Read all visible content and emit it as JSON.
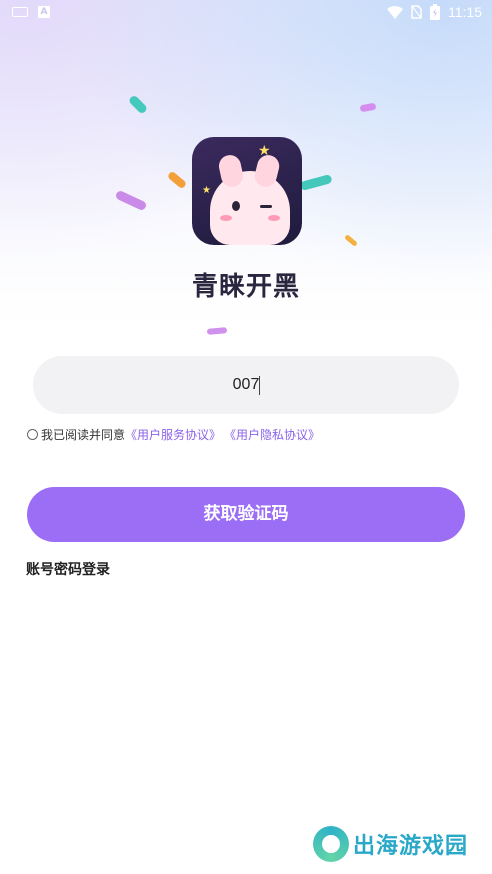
{
  "status_bar": {
    "time": "11:15",
    "icons": [
      "keyboard-icon",
      "a-icon",
      "wifi-icon",
      "no-sim-icon",
      "battery-icon"
    ]
  },
  "app": {
    "name": "青睐开黑",
    "logo_icon": "app-logo-bunny"
  },
  "form": {
    "phone_value": "007",
    "agreement": {
      "prefix": "我已阅读并同意",
      "service_link": "《用户服务协议》",
      "privacy_link": "《用户隐私协议》",
      "checked": false
    },
    "get_code_button": "获取验证码",
    "password_login_link": "账号密码登录"
  },
  "watermark": {
    "text": "出海游戏园"
  },
  "colors": {
    "accent": "#9b6ef5",
    "link": "#8a62e8",
    "input_bg": "#f2f2f4",
    "watermark": "#2aa8c8"
  }
}
